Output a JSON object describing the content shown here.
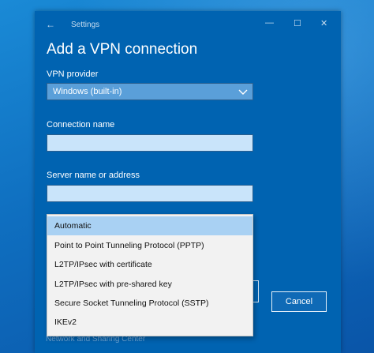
{
  "window": {
    "title": "Settings",
    "back_glyph": "←",
    "minimize_glyph": "—",
    "maximize_glyph": "☐",
    "close_glyph": "✕"
  },
  "form": {
    "heading": "Add a VPN connection",
    "vpn_provider_label": "VPN provider",
    "vpn_provider_value": "Windows (built-in)",
    "connection_name_label": "Connection name",
    "connection_name_value": "",
    "server_label": "Server name or address",
    "server_value": ""
  },
  "vpn_type_dropdown": {
    "options": [
      "Automatic",
      "Point to Point Tunneling Protocol (PPTP)",
      "L2TP/IPsec with certificate",
      "L2TP/IPsec with pre-shared key",
      "Secure Socket Tunneling Protocol (SSTP)",
      "IKEv2"
    ],
    "selected_index": 0
  },
  "buttons": {
    "cancel": "Cancel"
  },
  "footer": {
    "link_text": "Network and Sharing Center"
  },
  "colors": {
    "window_bg": "#0063b1",
    "selected_option_bg": "#a9d1f3",
    "textbox_bg": "#c9e4fa"
  },
  "icons": {
    "back": "back-arrow-icon",
    "chevron": "chevron-down-icon"
  }
}
